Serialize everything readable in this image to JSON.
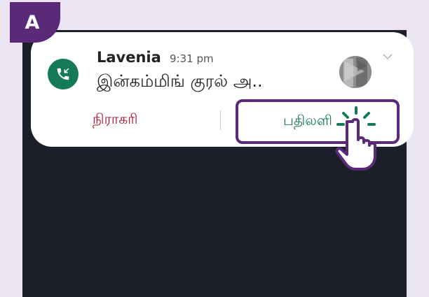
{
  "badge": {
    "label": "A"
  },
  "notification": {
    "caller_name": "Lavenia",
    "time": "9:31 pm",
    "message": "இன்கம்மிங் குரல் அ..",
    "decline_label": "நிராகரி",
    "answer_label": "பதிலளி"
  },
  "icons": {
    "call": "incoming-call-icon",
    "avatar": "contact-avatar",
    "expand": "chevron-down-icon",
    "tap": "tap-hand-icon"
  },
  "colors": {
    "accent": "#5a2a78",
    "call_green": "#157a5a",
    "decline_red": "#b0122e",
    "screen_dark": "#1c1f2a"
  }
}
